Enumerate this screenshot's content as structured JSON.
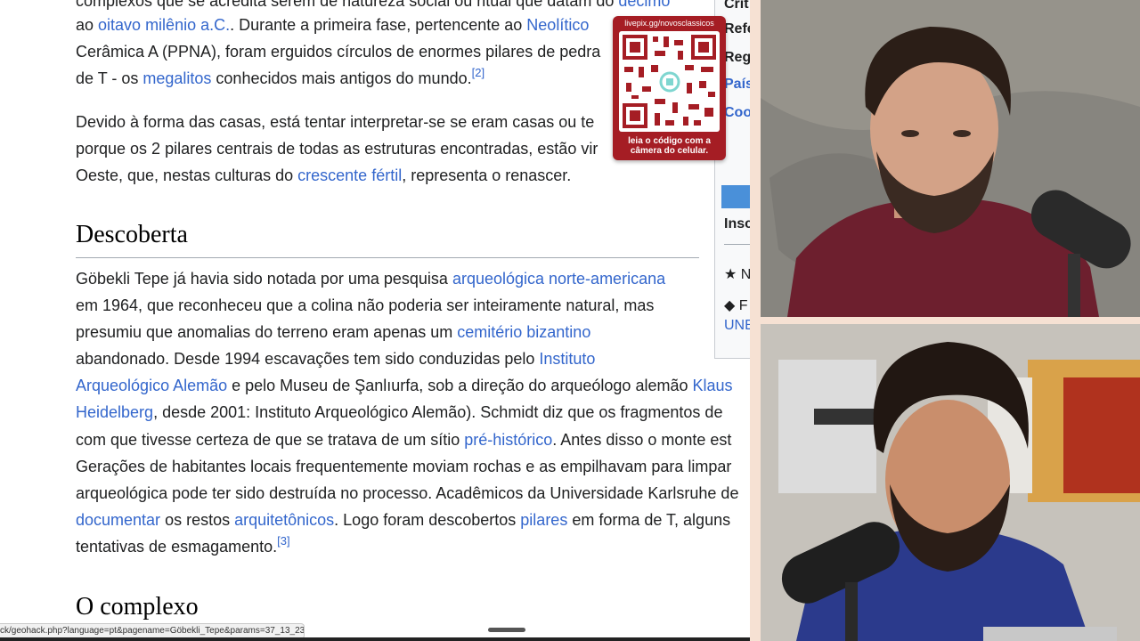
{
  "article": {
    "p1": {
      "line1_pre": "complexos que se acredita serem de natureza social ou ritual que datam do ",
      "line1_link": "décimo",
      "line2_pre": "ao ",
      "line2_link1": "oitavo milênio a.C.",
      "line2_mid": ". Durante a primeira fase, pertencente ao ",
      "line2_link2": "Neolítico",
      "line3": "Cerâmica A (PPNA), foram erguidos círculos de enormes pilares de pedra",
      "line4_pre": "de T - os ",
      "line4_link": "megalitos",
      "line4_post": " conhecidos mais antigos do mundo.",
      "ref": "[2]"
    },
    "p2": {
      "line1": "Devido à forma das casas, está tentar interpretar-se se eram casas ou te",
      "line2": "porque os 2 pilares centrais de todas as estruturas encontradas, estão vir",
      "line3_pre": "Oeste, que, nestas culturas do ",
      "line3_link": "crescente fértil",
      "line3_post": ", representa o renascer."
    },
    "heading1": "Descoberta",
    "p3": {
      "l1_pre": "Göbekli Tepe já havia sido notada por uma pesquisa ",
      "l1_link": "arqueológica norte-americana",
      "l2": "em 1964, que reconheceu que a colina não poderia ser inteiramente natural, mas",
      "l3_pre": "presumiu que anomalias do terreno eram apenas um ",
      "l3_link": "cemitério bizantino",
      "l4_pre": "abandonado. Desde 1994 escavações tem sido conduzidas pelo ",
      "l4_link": "Instituto",
      "l5_link": "Arqueológico Alemão",
      "l5_mid": " e pelo Museu de Şanlıurfa, sob a direção do arqueólogo alemão ",
      "l5_link2": "Klaus",
      "l6_link": "Heidelberg",
      "l6_post": ", desde 2001: Instituto Arqueológico Alemão). Schmidt diz que os fragmentos de",
      "l7_pre": "com que tivesse certeza de que se tratava de um sítio ",
      "l7_link": "pré-histórico",
      "l7_post": ". Antes disso o monte est",
      "l8": "Gerações de habitantes locais frequentemente moviam rochas e as empilhavam para limpar",
      "l9": "arqueológica pode ter sido destruída no processo. Acadêmicos da Universidade Karlsruhe de",
      "l10_link1": "documentar",
      "l10_mid1": " os restos ",
      "l10_link2": "arquitetônicos",
      "l10_mid2": ". Logo foram descobertos ",
      "l10_link3": "pilares",
      "l10_post": " em forma de T, alguns",
      "l11": "tentativas de esmagamento.",
      "ref": "[3]"
    },
    "heading2": "O complexo"
  },
  "qr_overlay": {
    "url": "livepix.gg/novosclassicos",
    "caption_line1": "leia o código com a",
    "caption_line2": "câmera do celular."
  },
  "infobox": {
    "rows": [
      "Crit",
      "Refe",
      "Regi",
      "País",
      "Coo"
    ],
    "insc": "Insc",
    "star_item": "★ N",
    "diamond_item": "◆ F",
    "unesco": "UNE"
  },
  "status_bar": {
    "url": "ck/geohack.php?language=pt&pagename=Göbekli_Tepe&params=37_13_23..."
  },
  "colors": {
    "link": "#3366cc",
    "text": "#202122",
    "qr_bg": "#a51d24"
  },
  "webcams": [
    "streamer-top-webcam",
    "streamer-bottom-webcam"
  ]
}
